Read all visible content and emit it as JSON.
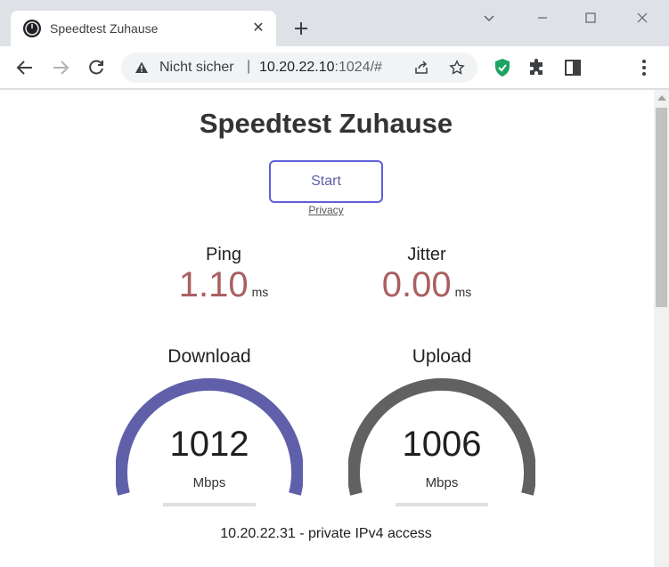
{
  "browser": {
    "tab_title": "Speedtest Zuhause",
    "security_label": "Nicht sicher",
    "separator": "|",
    "url_host": "10.20.22.10",
    "url_rest": ":1024/#"
  },
  "page": {
    "title": "Speedtest Zuhause",
    "start_label": "Start",
    "privacy_label": "Privacy",
    "ping": {
      "label": "Ping",
      "value": "1.10",
      "unit": "ms"
    },
    "jitter": {
      "label": "Jitter",
      "value": "0.00",
      "unit": "ms"
    },
    "download": {
      "label": "Download",
      "value": "1012",
      "unit": "Mbps",
      "color": "#6060aa"
    },
    "upload": {
      "label": "Upload",
      "value": "1006",
      "unit": "Mbps",
      "color": "#616161"
    },
    "ip_info": "10.20.22.31 - private IPv4 access"
  },
  "colors": {
    "accent": "#6060aa",
    "value_red": "#aa6060",
    "shield_green": "#1ea362"
  }
}
